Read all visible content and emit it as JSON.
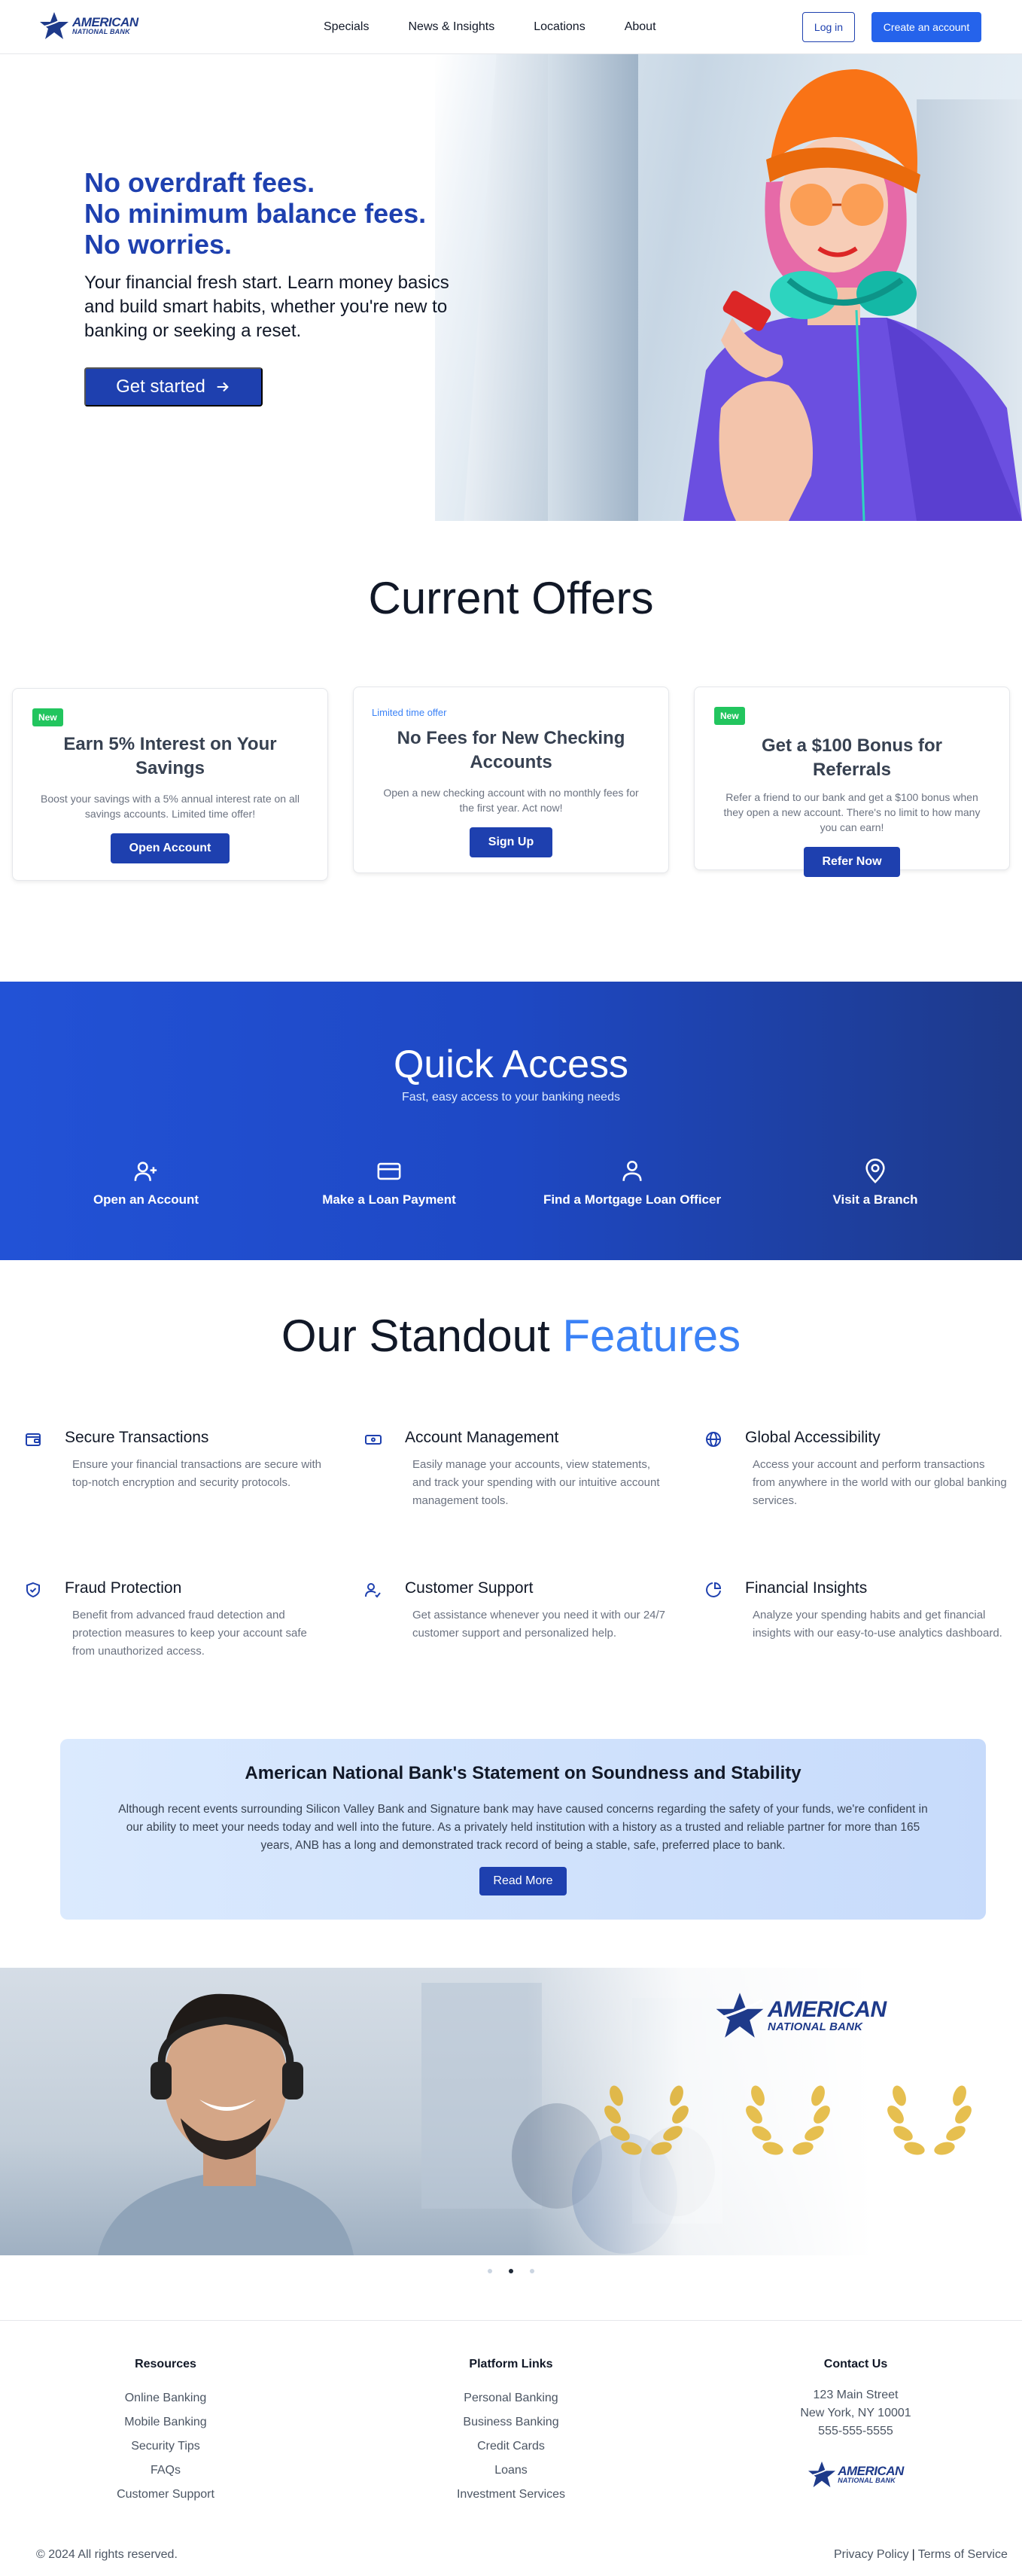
{
  "nav": {
    "logo_name": "AMERICAN",
    "logo_sub": "NATIONAL BANK",
    "links": [
      "Specials",
      "News & Insights",
      "Locations",
      "About"
    ],
    "login_label": "Log in",
    "create_label": "Create an account"
  },
  "hero": {
    "headline": [
      "No overdraft fees.",
      "No minimum balance fees.",
      "No worries."
    ],
    "body": "Your financial fresh start. Learn money basics and build smart habits, whether you're new to banking or seeking a reset.",
    "cta_label": "Get started"
  },
  "offers": {
    "title": "Current Offers",
    "cards": [
      {
        "badge": "New",
        "title": "Earn 5% Interest on Your Savings",
        "desc": "Boost your savings with a 5% annual interest rate on all savings accounts. Limited time offer!",
        "button": "Open Account"
      },
      {
        "badge": "Limited time offer",
        "title": "No Fees for New Checking Accounts",
        "desc": "Open a new checking account with no monthly fees for the first year. Act now!",
        "button": "Sign Up"
      },
      {
        "badge": "New",
        "title": "Get a $100 Bonus for Referrals",
        "desc": "Refer a friend to our bank and get a $100 bonus when they open a new account. There's no limit to how many you can earn!",
        "button": "Refer Now"
      }
    ]
  },
  "quick_access": {
    "title": "Quick Access",
    "subtitle": "Fast, easy access to your banking needs",
    "items": [
      {
        "label": "Open an Account",
        "icon": "user-plus-icon"
      },
      {
        "label": "Make a Loan Payment",
        "icon": "credit-card-icon"
      },
      {
        "label": "Find a Mortgage Loan Officer",
        "icon": "user-icon"
      },
      {
        "label": "Visit a Branch",
        "icon": "map-pin-icon"
      }
    ]
  },
  "features": {
    "title_main": "Our Standout",
    "title_accent": "Features",
    "items": [
      {
        "title": "Secure Transactions",
        "desc": "Ensure your financial transactions are secure with top-notch encryption and security protocols.",
        "icon": "wallet-icon"
      },
      {
        "title": "Account Management",
        "desc": "Easily manage your accounts, view statements, and track your spending with our intuitive account management tools.",
        "icon": "banknote-icon"
      },
      {
        "title": "Global Accessibility",
        "desc": "Access your account and perform transactions from anywhere in the world with our global banking services.",
        "icon": "globe-icon"
      },
      {
        "title": "Fraud Protection",
        "desc": "Benefit from advanced fraud detection and protection measures to keep your account safe from unauthorized access.",
        "icon": "shield-check-icon"
      },
      {
        "title": "Customer Support",
        "desc": "Get assistance whenever you need it with our 24/7 customer support and personalized help.",
        "icon": "user-check-icon"
      },
      {
        "title": "Financial Insights",
        "desc": "Analyze your spending habits and get financial insights with our easy-to-use analytics dashboard.",
        "icon": "pie-chart-icon"
      }
    ]
  },
  "statement": {
    "title": "American National Bank's Statement on Soundness and Stability",
    "body": "Although recent events surrounding Silicon Valley Bank and Signature bank may have caused concerns regarding the safety of your funds, we're confident in our ability to meet your needs today and well into the future. As a privately held institution with a history as a trusted and reliable partner for more than 165 years, ANB has a long and demonstrated track record of being a stable, safe, preferred place to bank.",
    "button": "Read More"
  },
  "banner": {
    "logo_name": "AMERICAN",
    "logo_sub": "NATIONAL BANK",
    "active_slide": 2,
    "slide_count": 3
  },
  "footer": {
    "resources": {
      "title": "Resources",
      "items": [
        "Online Banking",
        "Mobile Banking",
        "Security Tips",
        "FAQs",
        "Customer Support"
      ]
    },
    "platform": {
      "title": "Platform Links",
      "items": [
        "Personal Banking",
        "Business Banking",
        "Credit Cards",
        "Loans",
        "Investment Services"
      ]
    },
    "contact": {
      "title": "Contact Us",
      "items": [
        "123 Main Street",
        "New York, NY 10001",
        "555-555-5555"
      ]
    },
    "logo_name": "AMERICAN",
    "logo_sub": "NATIONAL BANK",
    "copyright": "© 2024 All rights reserved.",
    "privacy": "Privacy Policy",
    "terms": "Terms of Service"
  },
  "colors": {
    "brand": "#1e40af",
    "accent": "#3b82f6",
    "badge": "#22c55e"
  }
}
